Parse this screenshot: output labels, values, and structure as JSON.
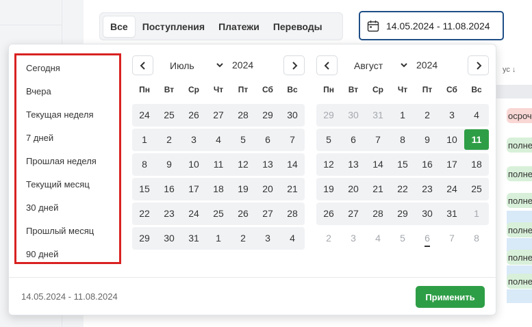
{
  "tabs": [
    {
      "label": "Все",
      "active": true
    },
    {
      "label": "Поступления",
      "active": false
    },
    {
      "label": "Платежи",
      "active": false
    },
    {
      "label": "Переводы",
      "active": false
    }
  ],
  "date_range_input": {
    "value": "14.05.2024 - 11.08.2024",
    "icon": "calendar-icon"
  },
  "background_table": {
    "header_fragment": "ус ↓",
    "status_fragments": [
      "осрочен",
      "полнена",
      "полнена",
      "полнена",
      "полнена",
      "полнена",
      "полнена"
    ]
  },
  "presets": [
    "Сегодня",
    "Вчера",
    "Текущая неделя",
    "7 дней",
    "Прошлая неделя",
    "Текущий месяц",
    "30 дней",
    "Прошлый месяц",
    "90 дней"
  ],
  "weekdays": [
    "Пн",
    "Вт",
    "Ср",
    "Чт",
    "Пт",
    "Сб",
    "Вс"
  ],
  "calendars": [
    {
      "month": "Июль",
      "year": "2024",
      "weeks": [
        [
          "24",
          "25",
          "26",
          "27",
          "28",
          "29",
          "30"
        ],
        [
          "1",
          "2",
          "3",
          "4",
          "5",
          "6",
          "7"
        ],
        [
          "8",
          "9",
          "10",
          "11",
          "12",
          "13",
          "14"
        ],
        [
          "15",
          "16",
          "17",
          "18",
          "19",
          "20",
          "21"
        ],
        [
          "22",
          "23",
          "24",
          "25",
          "26",
          "27",
          "28"
        ],
        [
          "29",
          "30",
          "31",
          "1",
          "2",
          "3",
          "4"
        ]
      ]
    },
    {
      "month": "Август",
      "year": "2024",
      "weeks": [
        [
          "29",
          "30",
          "31",
          "1",
          "2",
          "3",
          "4"
        ],
        [
          "5",
          "6",
          "7",
          "8",
          "9",
          "10",
          "11"
        ],
        [
          "12",
          "13",
          "14",
          "15",
          "16",
          "17",
          "18"
        ],
        [
          "19",
          "20",
          "21",
          "22",
          "23",
          "24",
          "25"
        ],
        [
          "26",
          "27",
          "28",
          "29",
          "30",
          "31",
          "1"
        ],
        [
          "2",
          "3",
          "4",
          "5",
          "6",
          "7",
          "8"
        ]
      ],
      "selected_day": "11",
      "today_day": "6"
    }
  ],
  "footer": {
    "range": "14.05.2024 - 11.08.2024",
    "apply_label": "Применить"
  },
  "colors": {
    "accent_green": "#2e9e46",
    "focus_blue": "#1f4e86",
    "highlight_red": "#d92121"
  }
}
